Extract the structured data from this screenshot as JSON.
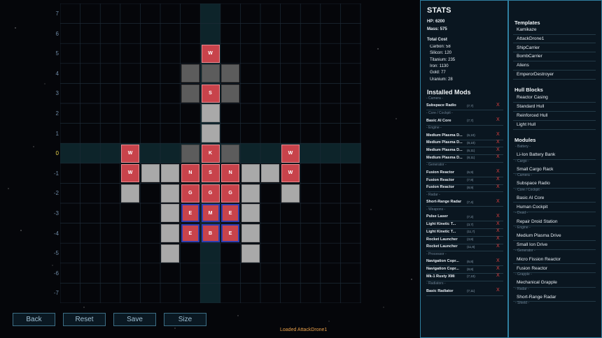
{
  "axis": [
    "7",
    "6",
    "5",
    "4",
    "3",
    "2",
    "1",
    "0",
    "-1",
    "-2",
    "-3",
    "-4",
    "-5",
    "-6",
    "-7"
  ],
  "cells": [
    {
      "c": 7,
      "r": 2,
      "t": "mod",
      "l": "W"
    },
    {
      "c": 6,
      "r": 3,
      "t": "dark",
      "l": ""
    },
    {
      "c": 7,
      "r": 3,
      "t": "dark",
      "l": ""
    },
    {
      "c": 8,
      "r": 3,
      "t": "dark",
      "l": ""
    },
    {
      "c": 6,
      "r": 4,
      "t": "dark",
      "l": ""
    },
    {
      "c": 7,
      "r": 4,
      "t": "mod",
      "l": "S"
    },
    {
      "c": 8,
      "r": 4,
      "t": "dark",
      "l": ""
    },
    {
      "c": 7,
      "r": 5,
      "t": "hull",
      "l": ""
    },
    {
      "c": 7,
      "r": 6,
      "t": "hull",
      "l": ""
    },
    {
      "c": 3,
      "r": 7,
      "t": "mod",
      "l": "W"
    },
    {
      "c": 6,
      "r": 7,
      "t": "dark",
      "l": ""
    },
    {
      "c": 7,
      "r": 7,
      "t": "mod",
      "l": "K"
    },
    {
      "c": 8,
      "r": 7,
      "t": "dark",
      "l": ""
    },
    {
      "c": 11,
      "r": 7,
      "t": "mod",
      "l": "W"
    },
    {
      "c": 3,
      "r": 8,
      "t": "mod",
      "l": "W"
    },
    {
      "c": 4,
      "r": 8,
      "t": "hull",
      "l": ""
    },
    {
      "c": 5,
      "r": 8,
      "t": "hull",
      "l": ""
    },
    {
      "c": 6,
      "r": 8,
      "t": "mod",
      "l": "N"
    },
    {
      "c": 7,
      "r": 8,
      "t": "mod",
      "l": "S"
    },
    {
      "c": 8,
      "r": 8,
      "t": "mod",
      "l": "N"
    },
    {
      "c": 9,
      "r": 8,
      "t": "hull",
      "l": ""
    },
    {
      "c": 10,
      "r": 8,
      "t": "hull",
      "l": ""
    },
    {
      "c": 11,
      "r": 8,
      "t": "mod",
      "l": "W"
    },
    {
      "c": 3,
      "r": 9,
      "t": "hull",
      "l": ""
    },
    {
      "c": 5,
      "r": 9,
      "t": "hull",
      "l": ""
    },
    {
      "c": 6,
      "r": 9,
      "t": "mod",
      "l": "G"
    },
    {
      "c": 7,
      "r": 9,
      "t": "mod",
      "l": "G"
    },
    {
      "c": 8,
      "r": 9,
      "t": "mod",
      "l": "G"
    },
    {
      "c": 9,
      "r": 9,
      "t": "hull",
      "l": ""
    },
    {
      "c": 11,
      "r": 9,
      "t": "hull",
      "l": ""
    },
    {
      "c": 5,
      "r": 10,
      "t": "hull",
      "l": ""
    },
    {
      "c": 6,
      "r": 10,
      "t": "eng",
      "l": "E"
    },
    {
      "c": 7,
      "r": 10,
      "t": "eng",
      "l": "M"
    },
    {
      "c": 8,
      "r": 10,
      "t": "eng",
      "l": "E"
    },
    {
      "c": 9,
      "r": 10,
      "t": "hull",
      "l": ""
    },
    {
      "c": 5,
      "r": 11,
      "t": "hull",
      "l": ""
    },
    {
      "c": 6,
      "r": 11,
      "t": "eng",
      "l": "E"
    },
    {
      "c": 7,
      "r": 11,
      "t": "eng",
      "l": "B"
    },
    {
      "c": 8,
      "r": 11,
      "t": "eng",
      "l": "E"
    },
    {
      "c": 9,
      "r": 11,
      "t": "hull",
      "l": ""
    },
    {
      "c": 5,
      "r": 12,
      "t": "hull",
      "l": ""
    },
    {
      "c": 9,
      "r": 12,
      "t": "hull",
      "l": ""
    }
  ],
  "buttons": [
    "Back",
    "Reset",
    "Save",
    "Size"
  ],
  "status": "Loaded AttackDrone1",
  "stats": {
    "title": "STATS",
    "hp": "HP: 6200",
    "mass": "Mass: 575",
    "cost_title": "Total Cost",
    "costs": [
      "Carbon: 58",
      "Silicon: 120",
      "Titanium: 235",
      "Iron: 1130",
      "Gold: 77",
      "Uranium: 28"
    ]
  },
  "mods": {
    "title": "Installed Mods",
    "rows": [
      {
        "k": "sect",
        "text": "- Camera -"
      },
      {
        "k": "mod",
        "text": "Subspace Radio",
        "slot": "(7,7)"
      },
      {
        "k": "sect",
        "text": "- Core / Cockpit -"
      },
      {
        "k": "mod",
        "text": "Basic AI Core",
        "slot": "(7,7)"
      },
      {
        "k": "sect",
        "text": "- Engine -"
      },
      {
        "k": "mod",
        "text": "Medium Plasma D...",
        "slot": "(6,10)"
      },
      {
        "k": "mod",
        "text": "Medium Plasma D...",
        "slot": "(8,10)"
      },
      {
        "k": "mod",
        "text": "Medium Plasma D...",
        "slot": "(6,11)"
      },
      {
        "k": "mod",
        "text": "Medium Plasma D...",
        "slot": "(8,11)"
      },
      {
        "k": "sect",
        "text": "- Generator -"
      },
      {
        "k": "mod",
        "text": "Fusion Reactor",
        "slot": "(6,9)"
      },
      {
        "k": "mod",
        "text": "Fusion Reactor",
        "slot": "(7,9)"
      },
      {
        "k": "mod",
        "text": "Fusion Reactor",
        "slot": "(8,9)"
      },
      {
        "k": "sect",
        "text": "- Radar -"
      },
      {
        "k": "mod",
        "text": "Short-Range Radar",
        "slot": "(7,4)"
      },
      {
        "k": "sect",
        "text": "- Weapons -"
      },
      {
        "k": "mod",
        "text": "Pulse Laser",
        "slot": "(7,2)"
      },
      {
        "k": "mod",
        "text": "Light Kinetic T...",
        "slot": "(3,7)"
      },
      {
        "k": "mod",
        "text": "Light Kinetic T...",
        "slot": "(11,7)"
      },
      {
        "k": "mod",
        "text": "Rocket Launcher",
        "slot": "(3,8)"
      },
      {
        "k": "mod",
        "text": "Rocket Launcher",
        "slot": "(11,8)"
      },
      {
        "k": "sect",
        "text": "- Processor -"
      },
      {
        "k": "mod",
        "text": "Navigation Copr...",
        "slot": "(6,8)"
      },
      {
        "k": "mod",
        "text": "Navigation Copr...",
        "slot": "(8,8)"
      },
      {
        "k": "mod",
        "text": "Mk-1 Rusty XMi",
        "slot": "(7,10)"
      },
      {
        "k": "sect",
        "text": "- Radiators -"
      },
      {
        "k": "mod",
        "text": "Basic Radiator",
        "slot": "(7,11)"
      }
    ]
  },
  "templates": {
    "title": "Templates",
    "items": [
      "Kamikaze",
      "AttackDrone1",
      "ShipCarrier",
      "BombCarrier",
      "Aliens",
      "EmperorDestroyer"
    ]
  },
  "hull": {
    "title": "Hull Blocks",
    "items": [
      "Reactor Casing",
      "Standard Hull",
      "Reinforced Hull",
      "Light Hull"
    ]
  },
  "modules": {
    "title": "Modules",
    "rows": [
      {
        "k": "sect",
        "text": "- Battery -"
      },
      {
        "k": "item",
        "text": "Li-Ion Battery Bank"
      },
      {
        "k": "sect",
        "text": "- Cargo -"
      },
      {
        "k": "item",
        "text": "Small Cargo Rack"
      },
      {
        "k": "sect",
        "text": "- Camera -"
      },
      {
        "k": "item",
        "text": "Subspace Radio"
      },
      {
        "k": "sect",
        "text": "- Core / Cockpit -"
      },
      {
        "k": "item",
        "text": "Basic AI Core"
      },
      {
        "k": "item",
        "text": "Human Cockpit"
      },
      {
        "k": "sect",
        "text": "- Droid -"
      },
      {
        "k": "item",
        "text": "Repair Droid Station"
      },
      {
        "k": "sect",
        "text": "- Engine -"
      },
      {
        "k": "item",
        "text": "Medium Plasma Drive"
      },
      {
        "k": "item",
        "text": "Small Ion Drive"
      },
      {
        "k": "sect",
        "text": "- Generator -"
      },
      {
        "k": "item",
        "text": "Micro Fission Reactor"
      },
      {
        "k": "item",
        "text": "Fusion Reactor"
      },
      {
        "k": "sect",
        "text": "- Grapple -"
      },
      {
        "k": "item",
        "text": "Mechanical Grapple"
      },
      {
        "k": "sect",
        "text": "- Radar -"
      },
      {
        "k": "item",
        "text": "Short-Range Radar"
      },
      {
        "k": "sect",
        "text": "- Shield -"
      }
    ]
  },
  "colors": {
    "accent": "#2f7fa0",
    "module": "#c8434b",
    "engine_border": "#2f3fb0",
    "remove": "#e04040",
    "status": "#e9a04a"
  },
  "icons": {
    "remove": "X"
  }
}
